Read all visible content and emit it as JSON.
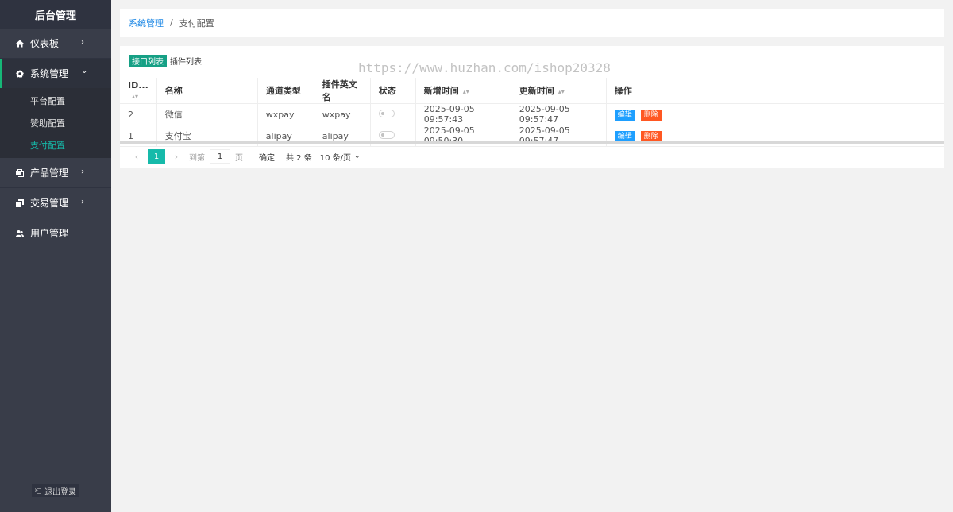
{
  "sidebar": {
    "brand": "后台管理",
    "items": [
      {
        "label": "仪表板",
        "icon": "home-icon"
      },
      {
        "label": "系统管理",
        "icon": "gear-icon",
        "open": true,
        "children": [
          {
            "label": "平台配置"
          },
          {
            "label": "赞助配置"
          },
          {
            "label": "支付配置",
            "active": true
          }
        ]
      },
      {
        "label": "产品管理",
        "icon": "products-icon"
      },
      {
        "label": "交易管理",
        "icon": "transactions-icon"
      },
      {
        "label": "用户管理",
        "icon": "users-icon"
      }
    ],
    "logout_label": "退出登录"
  },
  "breadcrumb": {
    "parent": "系统管理",
    "separator": "/",
    "current": "支付配置"
  },
  "tabs": [
    {
      "label": "接口列表",
      "active": true
    },
    {
      "label": "插件列表"
    }
  ],
  "watermark": "https://www.huzhan.com/ishop20328",
  "table": {
    "columns": [
      "ID...",
      "名称",
      "通道类型",
      "插件英文名",
      "状态",
      "新增时间",
      "更新时间",
      "操作"
    ],
    "rows": [
      {
        "id": "2",
        "name": "微信",
        "channel": "wxpay",
        "plugin": "wxpay",
        "status": false,
        "created": "2025-09-05 09:57:43",
        "updated": "2025-09-05 09:57:47"
      },
      {
        "id": "1",
        "name": "支付宝",
        "channel": "alipay",
        "plugin": "alipay",
        "status": false,
        "created": "2025-09-05 09:50:30",
        "updated": "2025-09-05 09:57:47"
      }
    ],
    "edit_label": "编辑",
    "delete_label": "删除"
  },
  "pager": {
    "current_page": "1",
    "goto_prefix": "到第",
    "goto_value": "1",
    "goto_suffix": "页",
    "confirm_label": "确定",
    "total_text": "共 2 条",
    "limit_label": "10 条/页"
  },
  "colors": {
    "sidebar_bg": "#393d49",
    "active_teal": "#16baaa",
    "edit_blue": "#1e9fff",
    "delete_orange": "#ff5722"
  }
}
